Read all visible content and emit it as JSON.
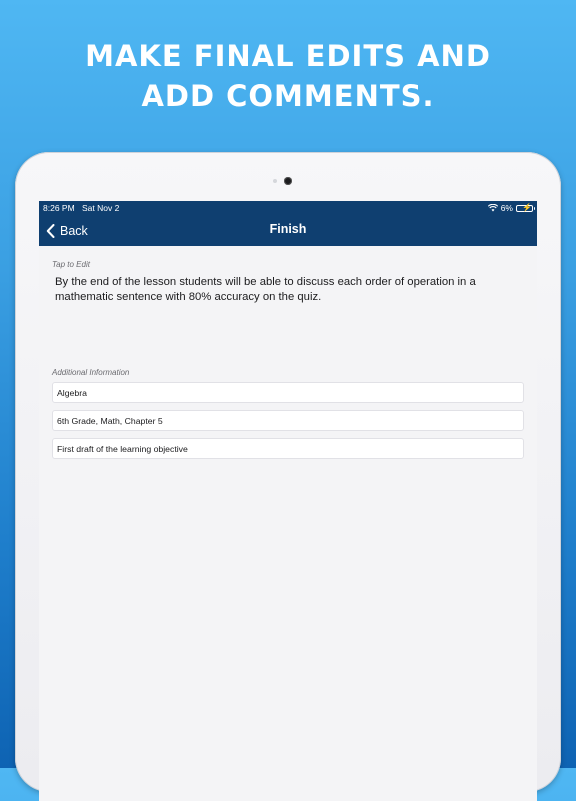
{
  "headline": {
    "line1": "MAKE FINAL EDITS AND",
    "line2": "ADD COMMENTS."
  },
  "status_bar": {
    "time": "8:26 PM",
    "date": "Sat Nov 2",
    "battery": "6%"
  },
  "navbar": {
    "back_label": "Back",
    "title": "Finish"
  },
  "objective": {
    "label": "Tap to Edit",
    "text": "By the end of the lesson students will be able to discuss each order of operation in a mathematic sentence with 80% accuracy on the quiz."
  },
  "additional_info": {
    "label": "Additional Information",
    "fields": [
      {
        "value": "Algebra"
      },
      {
        "value": "6th Grade, Math, Chapter 5"
      },
      {
        "value": "First draft of the learning objective"
      }
    ]
  },
  "colors": {
    "navbar": "#0f3f70",
    "background_top": "#4fb7f3",
    "background_bottom": "#0e63b3"
  },
  "icons": [
    "chevron-left-icon",
    "wifi-icon",
    "battery-icon"
  ]
}
